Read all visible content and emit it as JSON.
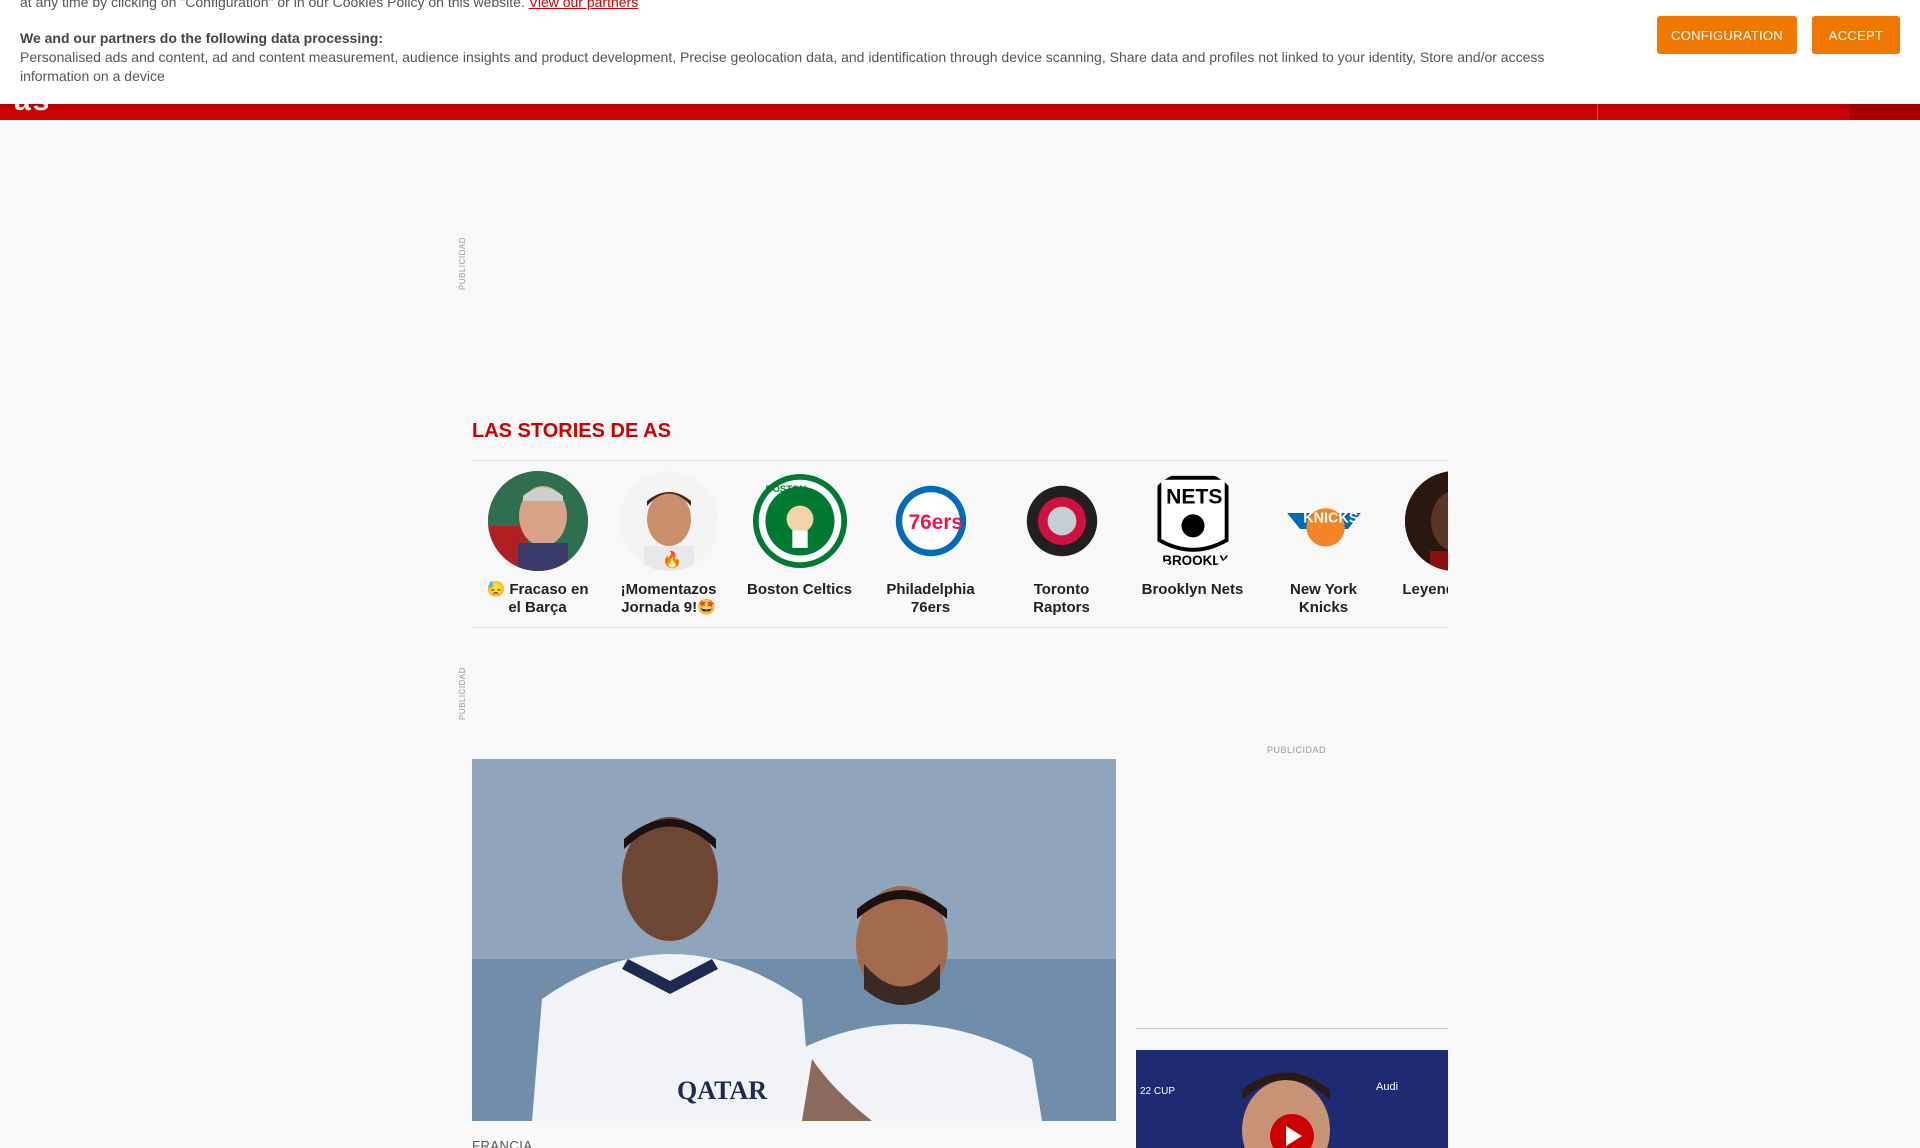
{
  "site": {
    "logo": "as"
  },
  "consent": {
    "cut_text": "at any time by clicking on \"Configuration\" or in our Cookies Policy on this website.",
    "partners_link": "View our partners",
    "heading": "We and our partners do the following data processing:",
    "body": "Personalised ads and content, ad and content measurement, audience insights and product development, Precise geolocation data, and identification through device scanning, Share data and profiles not linked to your identity, Store and/or access information on a device",
    "configuration_label": "CONFIGURATION",
    "accept_label": "ACCEPT"
  },
  "ads": {
    "label": "PUBLICIDAD"
  },
  "stories": {
    "title": "LAS STORIES DE AS",
    "items": [
      {
        "label": "😓 Fracaso en el Barça",
        "icon": "person-photo"
      },
      {
        "label": "¡Momentazos Jornada 9!🤩",
        "icon": "person-photo"
      },
      {
        "label": "Boston Celtics",
        "icon": "celtics-logo"
      },
      {
        "label": "Philadelphia 76ers",
        "icon": "76ers-logo"
      },
      {
        "label": "Toronto Raptors",
        "icon": "raptors-logo"
      },
      {
        "label": "Brooklyn Nets",
        "icon": "nets-logo"
      },
      {
        "label": "New York Knicks",
        "icon": "knicks-logo"
      },
      {
        "label": "Leyend mate a L",
        "icon": "person-photo"
      }
    ]
  },
  "article": {
    "section": "FRANCIA"
  },
  "colors": {
    "brand_red": "#cc0000",
    "button_orange": "#f07800"
  }
}
